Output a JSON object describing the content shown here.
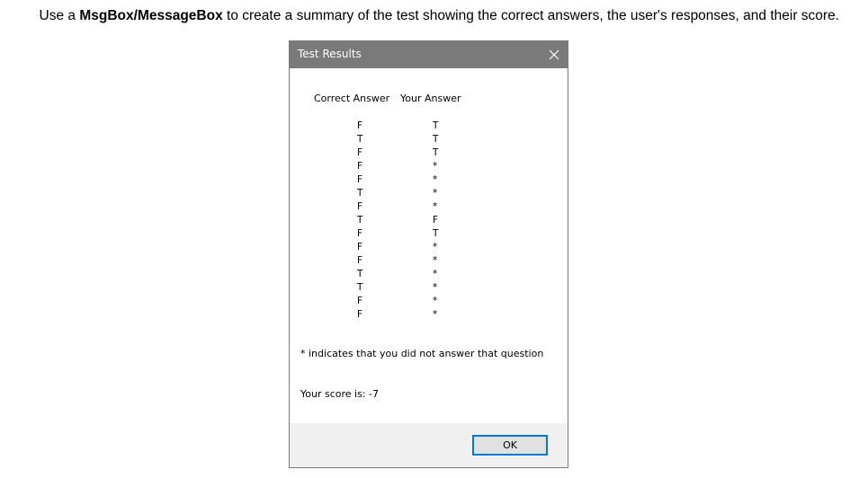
{
  "instruction": {
    "prefix": "Use a ",
    "bold": "MsgBox/MessageBox",
    "suffix": " to create a summary of the test showing the correct answers, the user's responses, and their score."
  },
  "dialog": {
    "title": "Test Results",
    "close_icon": "close-icon",
    "headers": {
      "correct": "Correct Answer",
      "yours": "Your Answer"
    },
    "correct_answers": [
      "F",
      "T",
      "F",
      "F",
      "F",
      "T",
      "F",
      "T",
      "F",
      "F",
      "F",
      "T",
      "T",
      "F",
      "F"
    ],
    "your_answers": [
      "T",
      "T",
      "T",
      "*",
      "*",
      "*",
      "*",
      "F",
      "T",
      "*",
      "*",
      "*",
      "*",
      "*",
      "*"
    ],
    "note": "* indicates that you did not answer that question",
    "score_text": "Your score is: -7",
    "ok_label": "OK"
  }
}
